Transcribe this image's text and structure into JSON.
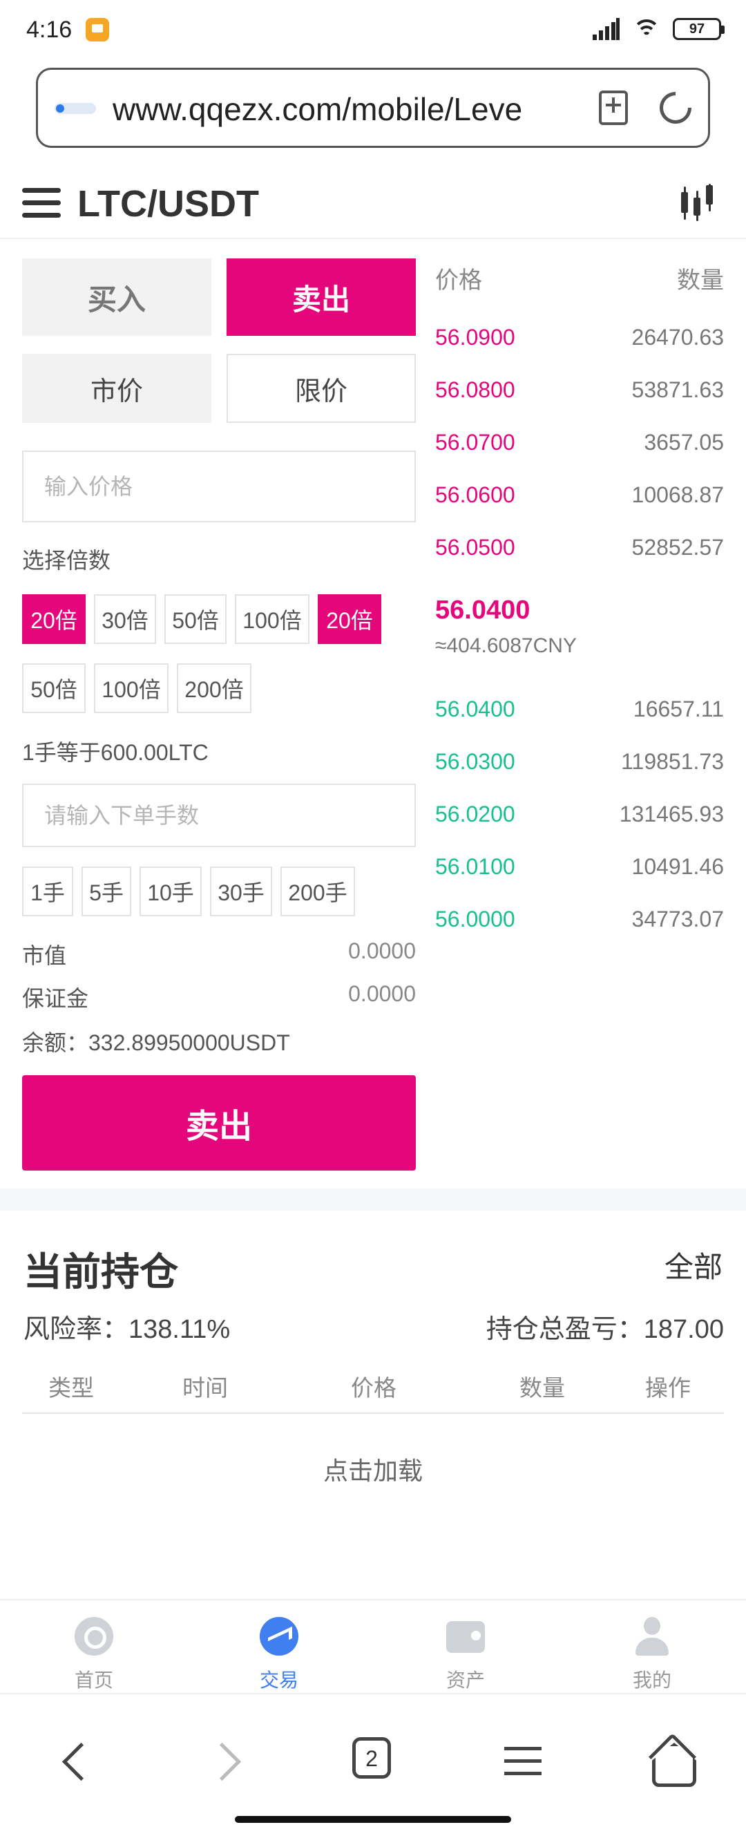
{
  "status_bar": {
    "time": "4:16",
    "battery": "97"
  },
  "browser": {
    "url": "www.qqezx.com/mobile/Leve",
    "tab_count": "2"
  },
  "header": {
    "title": "LTC/USDT"
  },
  "trade_form": {
    "side_buy": "买入",
    "side_sell": "卖出",
    "type_market": "市价",
    "type_limit": "限价",
    "price_placeholder": "输入价格",
    "leverage_label": "选择倍数",
    "leverage_options": [
      "20倍",
      "30倍",
      "50倍",
      "100倍",
      "20倍",
      "50倍",
      "100倍",
      "200倍"
    ],
    "lot_info": "1手等于600.00LTC",
    "qty_placeholder": "请输入下单手数",
    "lot_options": [
      "1手",
      "5手",
      "10手",
      "30手",
      "200手"
    ],
    "market_value_label": "市值",
    "market_value": "0.0000",
    "margin_label": "保证金",
    "margin": "0.0000",
    "balance": "余额：332.89950000USDT",
    "submit_label": "卖出",
    "accent_color": "#e6067c"
  },
  "order_book": {
    "price_header": "价格",
    "qty_header": "数量",
    "asks": [
      {
        "price": "56.0900",
        "qty": "26470.63"
      },
      {
        "price": "56.0800",
        "qty": "53871.63"
      },
      {
        "price": "56.0700",
        "qty": "3657.05"
      },
      {
        "price": "56.0600",
        "qty": "10068.87"
      },
      {
        "price": "56.0500",
        "qty": "52852.57"
      }
    ],
    "last_price": "56.0400",
    "last_price_cny": "≈404.6087CNY",
    "bids": [
      {
        "price": "56.0400",
        "qty": "16657.11"
      },
      {
        "price": "56.0300",
        "qty": "119851.73"
      },
      {
        "price": "56.0200",
        "qty": "131465.93"
      },
      {
        "price": "56.0100",
        "qty": "10491.46"
      },
      {
        "price": "56.0000",
        "qty": "34773.07"
      }
    ],
    "ask_color": "#e6067c",
    "bid_color": "#19c08f"
  },
  "positions": {
    "title": "当前持仓",
    "all_label": "全部",
    "risk_rate": "风险率：138.11%",
    "total_pnl": "持仓总盈亏：187.00",
    "columns": [
      "类型",
      "时间",
      "价格",
      "数量",
      "操作"
    ],
    "load_more": "点击加载"
  },
  "tabbar": {
    "items": [
      {
        "label": "首页",
        "icon": "home-icon"
      },
      {
        "label": "交易",
        "icon": "trade-icon"
      },
      {
        "label": "资产",
        "icon": "wallet-icon"
      },
      {
        "label": "我的",
        "icon": "user-icon"
      }
    ],
    "active_color": "#3f7ff0"
  }
}
